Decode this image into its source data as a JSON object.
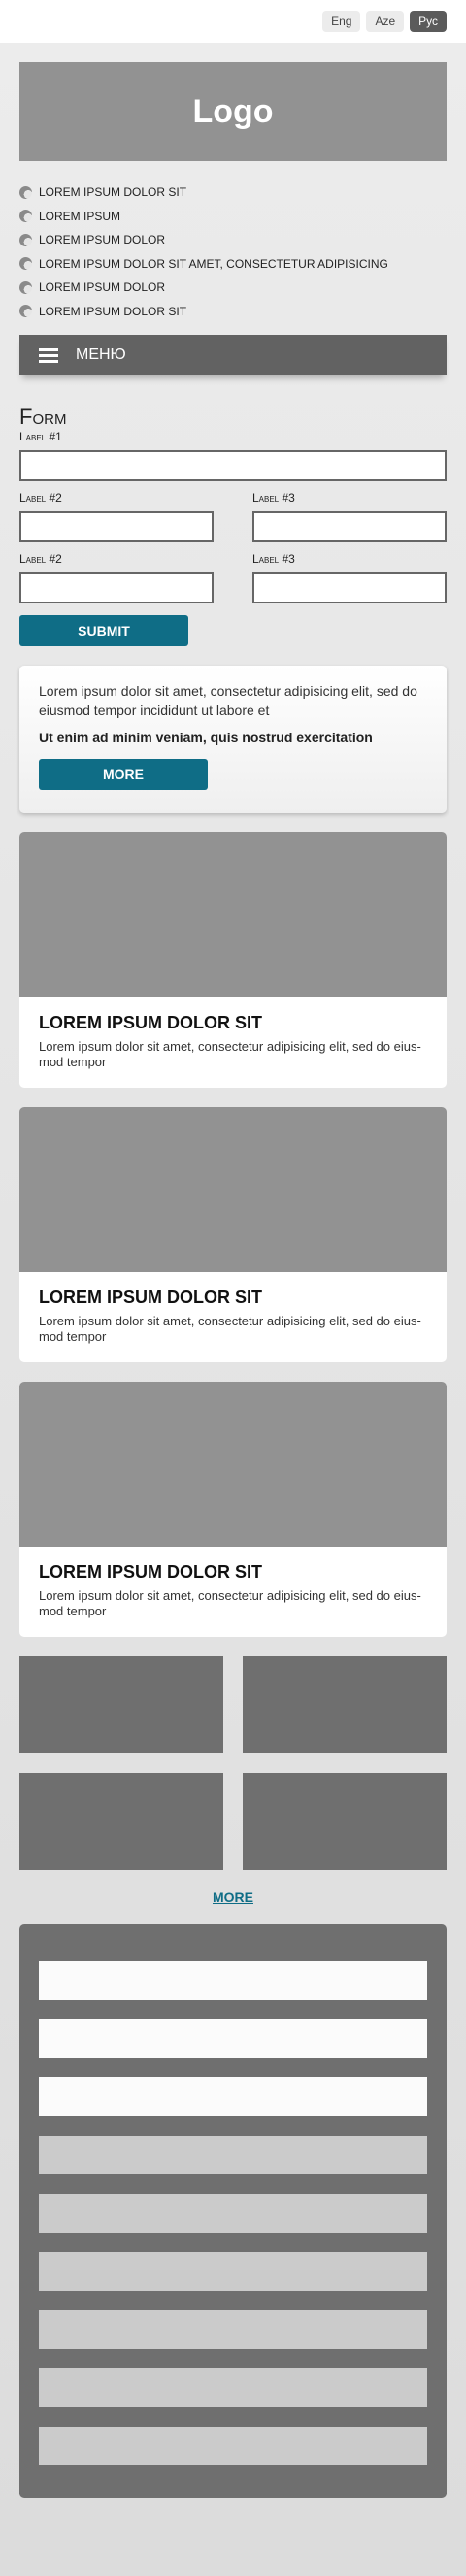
{
  "languages": [
    {
      "label": "Eng",
      "active": false
    },
    {
      "label": "Aze",
      "active": false
    },
    {
      "label": "Рус",
      "active": true
    }
  ],
  "logo": {
    "text": "Logo"
  },
  "bullets": [
    "LOREM IPSUM DOLOR SIT",
    "LOREM IPSUM",
    "LOREM IPSUM DOLOR",
    "LOREM IPSUM DOLOR SIT AMET, CONSECTETUR ADIPISICING",
    "LOREM IPSUM DOLOR",
    "LOREM IPSUM DOLOR SIT"
  ],
  "menu": {
    "label": "МЕНЮ"
  },
  "form": {
    "title": "Form",
    "label1": "Label #1",
    "label2a": "Label #2",
    "label3a": "Label #3",
    "label2b": "Label #2",
    "label3b": "Label #3",
    "submit": "SUBMIT"
  },
  "info": {
    "text": "Lorem ipsum dolor sit amet, consectetur adipisicing elit, sed do eiusmod tempor incididunt ut labore et",
    "bold": "Ut enim ad minim veniam, quis nostrud exercitation",
    "button": "MORE"
  },
  "cards": [
    {
      "title": "LOREM IPSUM DOLOR SIT",
      "text": "Lorem ipsum dolor sit amet, consectetur adipisicing elit, sed do eius-mod tempor"
    },
    {
      "title": "LOREM IPSUM DOLOR SIT",
      "text": "Lorem ipsum dolor sit amet, consectetur adipisicing elit, sed do eius-mod tempor"
    },
    {
      "title": "LOREM IPSUM DOLOR SIT",
      "text": "Lorem ipsum dolor sit amet, consectetur adipisicing elit, sed do eius-mod tempor"
    }
  ],
  "more_link": "MORE",
  "colors": {
    "accent": "#0f6d86",
    "placeholder": "#929292",
    "dark": "#626262"
  }
}
